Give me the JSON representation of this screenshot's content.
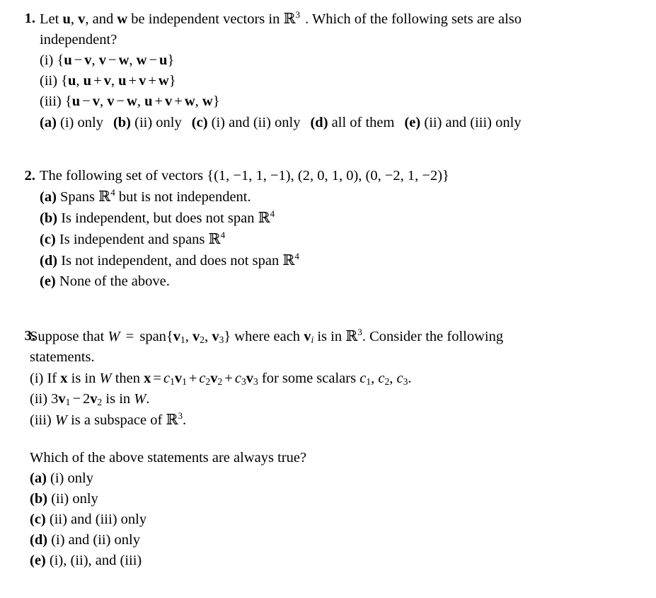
{
  "document": {
    "type": "multiple-choice-problem-set",
    "subject": "Linear algebra: independence, span, and subspaces",
    "background_color": "#ffffff",
    "text_color": "#000000"
  },
  "problems": [
    {
      "number": "1.",
      "stem_line_1_a": "Let ",
      "stem_u": "u",
      "stem_comma_1": ", ",
      "stem_v": "v",
      "stem_comma_2": ", and ",
      "stem_w": "w",
      "stem_line_1_b": " be independent vectors in ",
      "stem_blackboard_R": "R",
      "stem_exponent": "3",
      "stem_line_1_c": ". Which of the following sets are also",
      "stem_line_2": "independent?",
      "statements": [
        {
          "label": "(i)",
          "text": "{u − v, v − w, w − u}",
          "parts": [
            "{",
            "u",
            " − ",
            "v",
            ", ",
            "v",
            " − ",
            "w",
            ", ",
            "w",
            " − ",
            "u",
            "}"
          ]
        },
        {
          "label": "(ii)",
          "text": "{u, u + v, u + v + w}",
          "parts": [
            "{",
            "u",
            ", ",
            "u",
            " + ",
            "v",
            ", ",
            "u",
            " + ",
            "v",
            " + ",
            "w",
            "}"
          ]
        },
        {
          "label": "(iii)",
          "text": "{u − v, v − w, u + v + w, w}",
          "parts": [
            "{",
            "u",
            " − ",
            "v",
            ", ",
            "v",
            " − ",
            "w",
            ", ",
            "u",
            " + ",
            "v",
            " + ",
            "w",
            ", ",
            "w",
            "}"
          ]
        }
      ],
      "options_inline": [
        {
          "letter": "(a)",
          "text": "(i) only"
        },
        {
          "letter": "(b)",
          "text": "(ii) only"
        },
        {
          "letter": "(c)",
          "text": "(i) and (ii) only"
        },
        {
          "letter": "(d)",
          "text": "all of them"
        },
        {
          "letter": "(e)",
          "text": "(ii) and (iii) only"
        }
      ]
    },
    {
      "number": "2.",
      "stem_line_1": "The following set of vectors ",
      "vector_set": "{(1, −1, 1, −1), (2, 0, 1, 0), (0, −2, 1, −2)}",
      "vectors": [
        [
          1,
          -1,
          1,
          -1
        ],
        [
          2,
          0,
          1,
          0
        ],
        [
          0,
          -2,
          1,
          -2
        ]
      ],
      "options": [
        {
          "letter": "(a)",
          "text_before": "Spans ",
          "blackboard_R": "R",
          "exponent": "4",
          "text_after": " but is not independent."
        },
        {
          "letter": "(b)",
          "text_before": "Is independent, but does not span ",
          "blackboard_R": "R",
          "exponent": "4",
          "text_after": ""
        },
        {
          "letter": "(c)",
          "text_before": "Is independent and spans ",
          "blackboard_R": "R",
          "exponent": "4",
          "text_after": ""
        },
        {
          "letter": "(d)",
          "text_before": "Is not independent, and does not span ",
          "blackboard_R": "R",
          "exponent": "4",
          "text_after": ""
        },
        {
          "letter": "(e)",
          "text_before": "None of the above.",
          "blackboard_R": "",
          "exponent": "",
          "text_after": ""
        }
      ]
    },
    {
      "number": "3.",
      "stem_prefix": "Suppose that ",
      "stem_W": "W",
      "stem_equals": "=",
      "stem_span": "span",
      "stem_set": "{v1, v2, v3}",
      "stem_mid": " where each ",
      "stem_v_sub_i": "vi",
      "stem_is_in": " is in ",
      "stem_blackboard_R": "R",
      "stem_exponent": "3",
      "stem_suffix": ". Consider the following",
      "stem_line_2": "statements.",
      "statements": [
        {
          "label": "(i)",
          "text": "If x is in W then x = c1v1 + c2v2 + c3v3 for some scalars c1, c2, c3."
        },
        {
          "label": "(ii)",
          "text": "3v1 − 2v2 is in W."
        },
        {
          "label": "(iii)",
          "text": "W is a subspace of R3."
        }
      ],
      "question_line": "Which of the above statements are always true?",
      "options": [
        {
          "letter": "(a)",
          "text": "(i) only"
        },
        {
          "letter": "(b)",
          "text": "(ii) only"
        },
        {
          "letter": "(c)",
          "text": "(ii) and (iii) only"
        },
        {
          "letter": "(d)",
          "text": "(i) and (ii) only"
        },
        {
          "letter": "(e)",
          "text": "(i), (ii), and (iii)"
        }
      ]
    }
  ]
}
